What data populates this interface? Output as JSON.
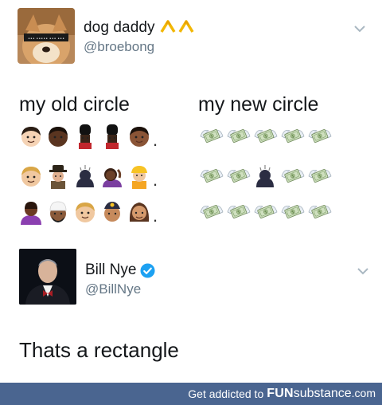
{
  "tweet": {
    "display_name": "dog daddy",
    "name_decoration": "^^",
    "handle": "@broebong"
  },
  "headings": {
    "old": "my old circle",
    "new": "my new circle"
  },
  "old_circle_rows": [
    [
      "face-light",
      "face-dark",
      "guard-dark",
      "guard-dark",
      "face-brown"
    ],
    [
      "face-light-blond",
      "detective",
      "dark-person-sparkles",
      "woman-hand-purple",
      "construction-worker"
    ],
    [
      "woman-purple",
      "man-turban",
      "face-light-blond",
      "man-beret",
      "woman-brown"
    ]
  ],
  "new_circle_rows": [
    [
      "money-wings",
      "money-wings",
      "money-wings",
      "money-wings",
      "money-wings"
    ],
    [
      "money-wings",
      "money-wings",
      "dark-person-sparkles",
      "money-wings",
      "money-wings"
    ],
    [
      "money-wings",
      "money-wings",
      "money-wings",
      "money-wings",
      "money-wings"
    ]
  ],
  "reply": {
    "display_name": "Bill Nye",
    "handle": "@BillNye",
    "text": "Thats a rectangle"
  },
  "footer": {
    "prefix": "Get addicted to",
    "brand": "FUN",
    "brand_sub": "substance",
    "suffix": ".com"
  },
  "colors": {
    "verified": "#1da1f2",
    "footer_bg": "#4a6590",
    "handle": "#657786"
  }
}
